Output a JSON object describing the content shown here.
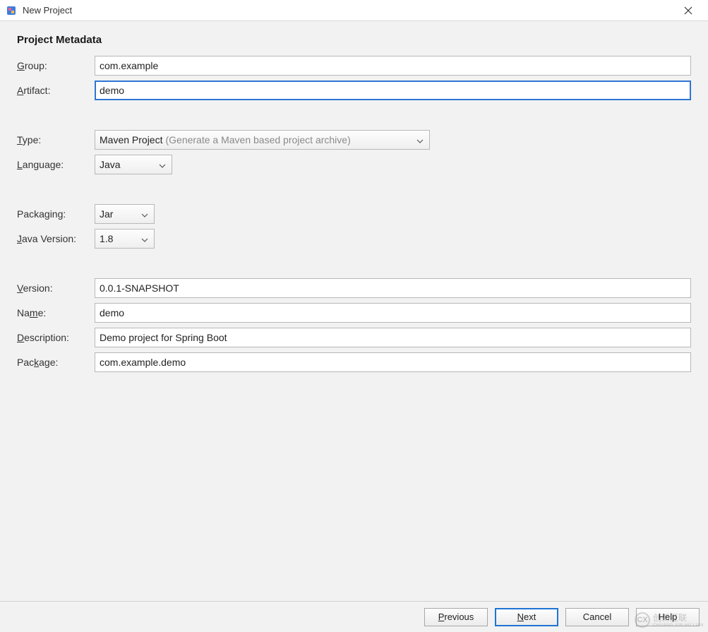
{
  "window": {
    "title": "New Project"
  },
  "section": {
    "title": "Project Metadata"
  },
  "labels": {
    "group": "Group:",
    "artifact": "Artifact:",
    "type": "Type:",
    "language": "Language:",
    "packaging": "Packaging:",
    "javaVersion": "Java Version:",
    "version": "Version:",
    "name": "Name:",
    "description": "Description:",
    "package": "Package:"
  },
  "fields": {
    "group": "com.example",
    "artifact": "demo",
    "type": {
      "value": "Maven Project",
      "hint": "(Generate a Maven based project archive)"
    },
    "language": "Java",
    "packaging": "Jar",
    "javaVersion": "1.8",
    "version": "0.0.1-SNAPSHOT",
    "name": "demo",
    "description": "Demo project for Spring Boot",
    "package": "com.example.demo"
  },
  "buttons": {
    "previous": "Previous",
    "next": "Next",
    "cancel": "Cancel",
    "help": "Help"
  },
  "watermark": {
    "brand": "创新互联",
    "sub": "CHUANG XIN HU LIAN"
  }
}
